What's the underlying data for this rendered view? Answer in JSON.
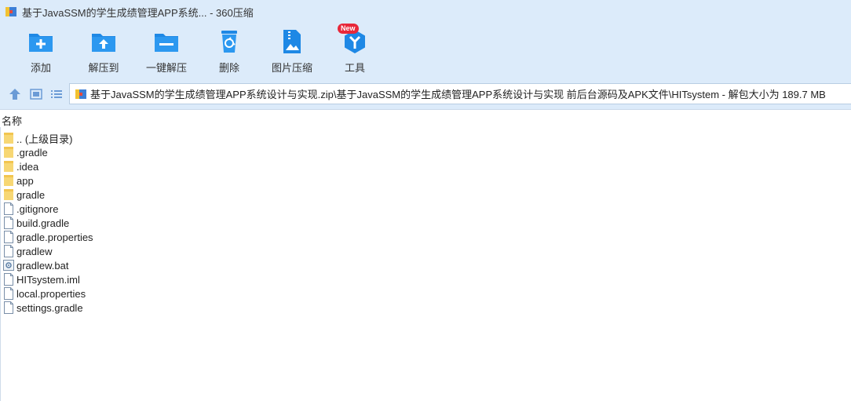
{
  "window": {
    "title": "基于JavaSSM的学生成绩管理APP系统... - 360压缩"
  },
  "toolbar": {
    "add": "添加",
    "extract_to": "解压到",
    "one_click_extract": "一键解压",
    "delete": "删除",
    "image_compress": "图片压缩",
    "tools": "工具",
    "new_badge": "New"
  },
  "address": {
    "path": "基于JavaSSM的学生成绩管理APP系统设计与实现.zip\\基于JavaSSM的学生成绩管理APP系统设计与实现 前后台源码及APK文件\\HITsystem - 解包大小为 189.7 MB"
  },
  "list": {
    "column_name": "名称",
    "items": [
      {
        "name": ".. (上级目录)",
        "type": "folder"
      },
      {
        "name": ".gradle",
        "type": "folder"
      },
      {
        "name": ".idea",
        "type": "folder"
      },
      {
        "name": "app",
        "type": "folder"
      },
      {
        "name": "gradle",
        "type": "folder"
      },
      {
        "name": ".gitignore",
        "type": "file"
      },
      {
        "name": "build.gradle",
        "type": "file"
      },
      {
        "name": "gradle.properties",
        "type": "file"
      },
      {
        "name": "gradlew",
        "type": "file"
      },
      {
        "name": "gradlew.bat",
        "type": "bat"
      },
      {
        "name": "HITsystem.iml",
        "type": "file"
      },
      {
        "name": "local.properties",
        "type": "file"
      },
      {
        "name": "settings.gradle",
        "type": "file"
      }
    ]
  },
  "colors": {
    "chrome_bg": "#dcebfa",
    "icon_blue": "#1e88e5",
    "folder_yellow": "#f7d774",
    "badge_red": "#e8283a"
  }
}
